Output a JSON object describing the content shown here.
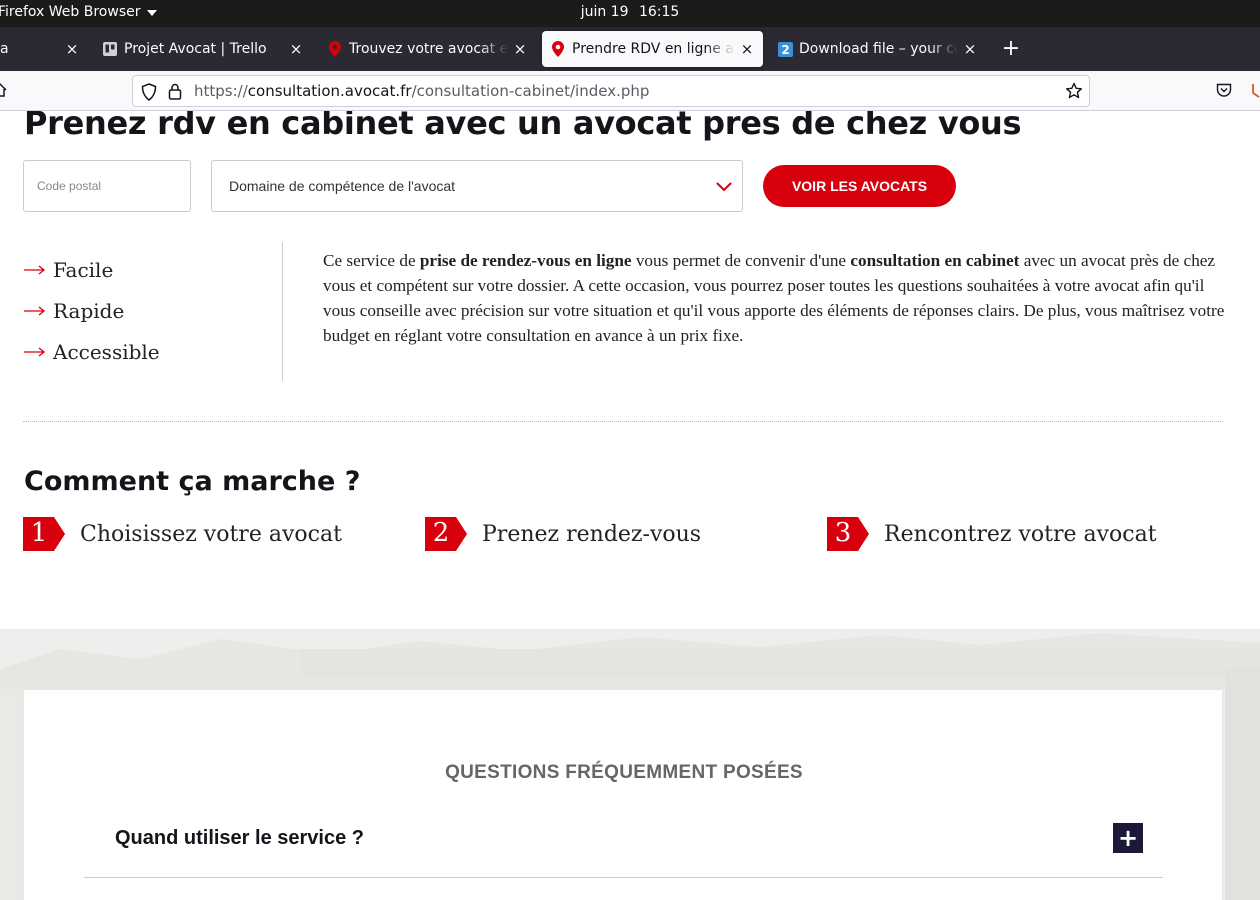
{
  "topbar": {
    "app_name": "Firefox Web Browser",
    "date": "juin 19",
    "time": "16:15"
  },
  "tabs": [
    {
      "title": "a",
      "close": "×",
      "favicon": "partial-tab",
      "active": false
    },
    {
      "title": "Projet Avocat | Trello",
      "close": "×",
      "favicon": "trello-icon",
      "active": false
    },
    {
      "title": "Trouvez votre avocat et consultez",
      "close": "×",
      "favicon": "map-pin-icon",
      "active": false
    },
    {
      "title": "Prendre RDV en ligne avec un avocat",
      "close": "×",
      "favicon": "map-pin-icon",
      "active": true
    },
    {
      "title": "Download file – your converted file",
      "close": "×",
      "favicon": "download-2-icon",
      "active": false
    }
  ],
  "new_tab": "+",
  "urlbar": {
    "scheme": "https://",
    "host": "consultation.avocat.fr",
    "path": "/consultation-cabinet/index.php"
  },
  "page": {
    "heading": "Prenez rdv en cabinet avec un avocat pres de chez vous",
    "search": {
      "zip_placeholder": "Code postal",
      "domain_placeholder": "Domaine de compétence de l'avocat",
      "button": "VOIR LES AVOCATS"
    },
    "features": [
      "Facile",
      "Rapide",
      "Accessible"
    ],
    "description": {
      "p1": "Ce service de ",
      "b1": "prise de rendez-vous en ligne",
      "p2": " vous permet de convenir d'une ",
      "b2": "consultation en cabinet",
      "p3": " avec un avocat près de chez vous et compétent sur votre dossier. A cette occasion, vous pourrez poser toutes les questions souhaitées à votre avocat afin qu'il vous conseille avec précision sur votre situation et qu'il vous apporte des éléments de réponses clairs. De plus, vous maîtrisez votre budget en réglant votre consultation en avance à un prix fixe."
    },
    "how_title": "Comment ça marche ?",
    "steps": [
      {
        "num": "1",
        "label": "Choisissez votre avocat"
      },
      {
        "num": "2",
        "label": "Prenez rendez-vous"
      },
      {
        "num": "3",
        "label": "Rencontrez votre avocat"
      }
    ],
    "faq": {
      "title": "QUESTIONS FRÉQUEMMENT POSÉES",
      "question": "Quand utiliser le service ?",
      "toggle": "+"
    }
  },
  "colors": {
    "accent": "#d8000c",
    "faq_toggle_bg": "#1a1a38",
    "tabstrip": "#2b2a33",
    "topbar": "#1b1b1b"
  }
}
